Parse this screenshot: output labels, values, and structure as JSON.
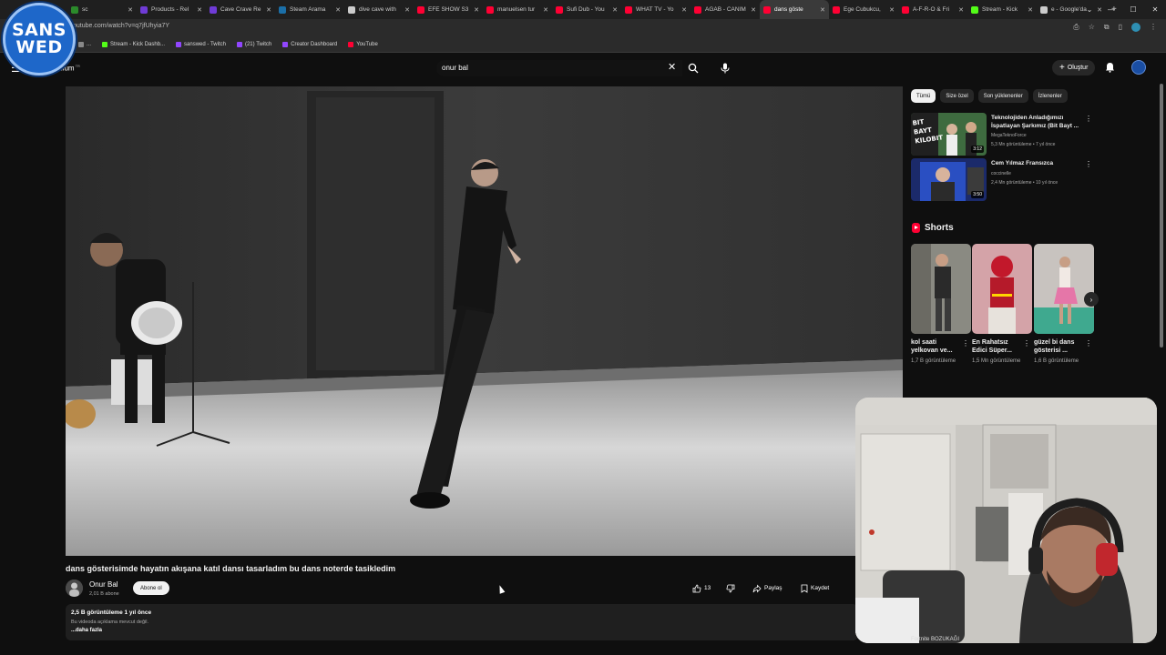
{
  "browser": {
    "tabs": [
      {
        "label": "sc",
        "color": "#2b8a2b",
        "active": false
      },
      {
        "label": "Products - Rel",
        "color": "#6f3bd6",
        "active": false
      },
      {
        "label": "Cave Crave Re",
        "color": "#6f3bd6",
        "active": false
      },
      {
        "label": "Steam Arama",
        "color": "#1b6fa8",
        "active": false
      },
      {
        "label": "dive cave with",
        "color": "#cccccc",
        "active": false
      },
      {
        "label": "EFE SHOW S3",
        "color": "#ff0033",
        "active": false
      },
      {
        "label": "manuelsen tur",
        "color": "#ff0033",
        "active": false
      },
      {
        "label": "Sufi Dub - You",
        "color": "#ff0033",
        "active": false
      },
      {
        "label": "WHAT TV - Yo",
        "color": "#ff0033",
        "active": false
      },
      {
        "label": "AGAB - CANIM",
        "color": "#ff0033",
        "active": false
      },
      {
        "label": "dans göste",
        "color": "#ff0033",
        "active": true
      },
      {
        "label": "Ege Cubukcu,",
        "color": "#ff0033",
        "active": false
      },
      {
        "label": "A-F-R-O & Fri",
        "color": "#ff0033",
        "active": false
      },
      {
        "label": "Stream - Kick",
        "color": "#53fc18",
        "active": false
      },
      {
        "label": "e - Google'da",
        "color": "#cccccc",
        "active": false
      }
    ],
    "url": "outube.com/watch?v=q7jfUhyia7Y",
    "bookmarks": [
      {
        "label": "...",
        "color": "#888888"
      },
      {
        "label": "Stream - Kick Dashb...",
        "color": "#53fc18"
      },
      {
        "label": "sanswed - Twitch",
        "color": "#9146ff"
      },
      {
        "label": "(21) Twitch",
        "color": "#9146ff"
      },
      {
        "label": "Creator Dashboard",
        "color": "#9146ff"
      },
      {
        "label": "YouTube",
        "color": "#ff0033"
      }
    ]
  },
  "overlay": {
    "logo_line1": "SANS",
    "logo_line2": "WED"
  },
  "header": {
    "logo_text": "mium",
    "logo_sup": "TR",
    "search_value": "onur bal",
    "create_label": "Oluştur"
  },
  "video": {
    "title": "dans gösterisimde hayatın akışana katıl dansı tasarladım bu dans noterde tasikledim",
    "channel": "Onur Bal",
    "subscribers": "2,01 B abone",
    "subscribe_label": "Abone ol",
    "likes": "13",
    "share_label": "Paylaş",
    "save_label": "Kaydet",
    "views_time": "2,5 B görüntüleme  1 yıl önce",
    "description": "Bu videoda açıklama mevcut değil.",
    "more_label": "...daha fazla"
  },
  "chips": [
    "Tümü",
    "Size özel",
    "Son yüklenenler",
    "İzlenenler"
  ],
  "recommendations": [
    {
      "title": "Teknolojiden Anladığımızı İspatlayan Şarkımız (Bit Bayt ...",
      "channel": "MegaTeknoForce",
      "meta": "5,3 Mn görüntüleme • 7 yıl önce",
      "duration": "3:12",
      "thumb_text": "BIT BAYT KILOBIT"
    },
    {
      "title": "Cem Yılmaz Fransızca",
      "channel": "coccinelle",
      "meta": "2,4 Mn görüntüleme • 10 yıl önce",
      "duration": "3:50",
      "thumb_text": ""
    }
  ],
  "shorts": {
    "heading": "Shorts",
    "items": [
      {
        "title": "kol saati yelkovan ve...",
        "views": "1,7 B görüntüleme"
      },
      {
        "title": "En Rahatsız Edici Süper...",
        "views": "1,5 Mn görüntüleme"
      },
      {
        "title": "güzel bi dans gösterisi ...",
        "views": "1,6 B görüntüleme"
      }
    ]
  },
  "below_cam": {
    "channel": "Fortnite BOZUKAĞI"
  }
}
